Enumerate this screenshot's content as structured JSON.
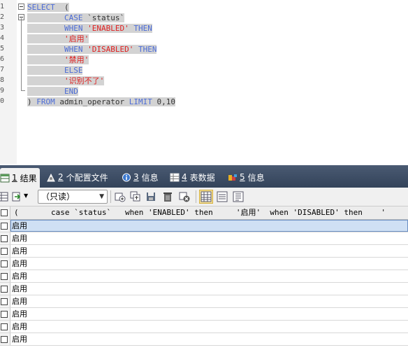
{
  "editor": {
    "line_numbers": [
      "1",
      "2",
      "3",
      "4",
      "5",
      "6",
      "7",
      "8",
      "9",
      "0"
    ],
    "lines": [
      [
        {
          "t": "SELECT",
          "c": "kw"
        },
        {
          "t": "  (",
          "c": "txt"
        }
      ],
      [
        {
          "t": "        CASE ",
          "c": "kw"
        },
        {
          "t": "`status`",
          "c": "txt"
        }
      ],
      [
        {
          "t": "        WHEN ",
          "c": "kw"
        },
        {
          "t": "'ENABLED'",
          "c": "str"
        },
        {
          "t": " THEN",
          "c": "kw"
        }
      ],
      [
        {
          "t": "        '启用'",
          "c": "str"
        }
      ],
      [
        {
          "t": "        WHEN ",
          "c": "kw"
        },
        {
          "t": "'DISABLED'",
          "c": "str"
        },
        {
          "t": " THEN",
          "c": "kw"
        }
      ],
      [
        {
          "t": "        '禁用'",
          "c": "str"
        }
      ],
      [
        {
          "t": "        ELSE",
          "c": "kw"
        }
      ],
      [
        {
          "t": "        '识别不了'",
          "c": "str"
        }
      ],
      [
        {
          "t": "        END",
          "c": "kw"
        }
      ],
      [
        {
          "t": ") ",
          "c": "txt"
        },
        {
          "t": "FROM ",
          "c": "kw"
        },
        {
          "t": "admin_operator ",
          "c": "txt"
        },
        {
          "t": "LIMIT ",
          "c": "kw"
        },
        {
          "t": "0,10",
          "c": "txt"
        }
      ]
    ]
  },
  "tabs": [
    {
      "num": "1",
      "label": "结果",
      "icon": "table-result-icon",
      "active": true
    },
    {
      "num": "2",
      "label": "个配置文件",
      "icon": "profile-icon",
      "active": false
    },
    {
      "num": "3",
      "label": "信息",
      "icon": "info-icon",
      "active": false
    },
    {
      "num": "4",
      "label": "表数据",
      "icon": "table-data-icon",
      "active": false
    },
    {
      "num": "5",
      "label": "信息",
      "icon": "messages-icon",
      "active": false
    }
  ],
  "toolbar": {
    "readonly_label": "（只读）"
  },
  "grid": {
    "header": "(       case `status`   when 'ENABLED' then     '启用'  when 'DISABLED' then    '",
    "rows": [
      "启用",
      "启用",
      "启用",
      "启用",
      "启用",
      "启用",
      "启用",
      "启用",
      "启用",
      "启用"
    ]
  },
  "colors": {
    "keyword": "#4b6bd6",
    "string": "#e02020",
    "tabbar": "#3d4d66",
    "selection": "#cfe0f4"
  }
}
